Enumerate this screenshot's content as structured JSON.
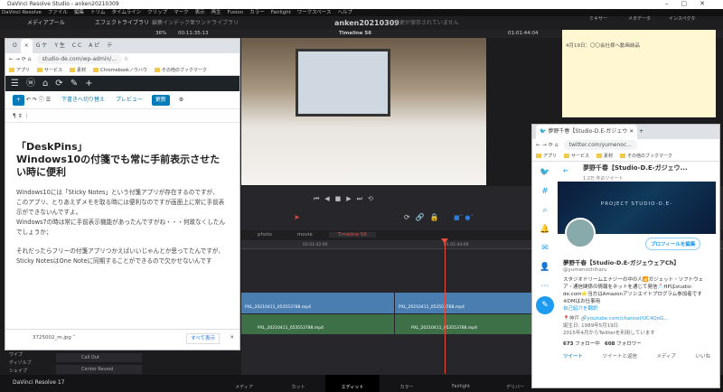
{
  "app": {
    "title": "DaVinci Resolve Studio - anken20210309",
    "menu": [
      "DaVinci Resolve",
      "ファイル",
      "編集",
      "トリム",
      "タイムライン",
      "クリップ",
      "マーク",
      "表示",
      "再生",
      "Fusion",
      "カラー",
      "Fairlight",
      "ワークスペース",
      "ヘルプ"
    ],
    "toolbar": {
      "media_pool": "メディアプール",
      "effects": "エフェクトライブラリ",
      "edit_index": "編集インデックス",
      "sound_library": "サウンドライブラリ",
      "project": "anken20210309",
      "unsaved": "変更が保存されていません",
      "mixer": "ミキサー",
      "metadata": "メタデータ",
      "inspector": "インスペクタ"
    },
    "viewer": {
      "zoom": "36%",
      "timecode": "00:11:35:13",
      "timeline_name": "Timeline 56",
      "current_tc": "01:01:44:04"
    },
    "timeline": {
      "tabs": [
        "photo",
        "movie",
        "Timeline 56"
      ],
      "ruler": [
        "01:01:42:00",
        "01:01:44:00"
      ],
      "clips": [
        "PXL_20210411_053553788.mp4",
        "PXL_20210411_053553788.mp4"
      ]
    },
    "effects_list": [
      "Call Out",
      "Center Reveal"
    ],
    "side_items": [
      "ワイプ",
      "ディゾルブ",
      "シェイプ"
    ],
    "pages": [
      "メディア",
      "カット",
      "エディット",
      "カラー",
      "Fairlight",
      "デリバー"
    ],
    "active_page": "エディット",
    "brand": "DaVinci Resolve 17",
    "accent": "#e64b3c"
  },
  "wp_browser": {
    "tabs": [
      "O",
      "×",
      "G ケ",
      "Y 生",
      "C C",
      "A ピ",
      "テ"
    ],
    "url": "studio-de.com/wp-admin/...",
    "bookmarks": [
      "アプリ",
      "サービス",
      "素材",
      "Chromebookノウハウ",
      "その他のブックマーク"
    ],
    "editor": {
      "draft": "下書きへ切り替え",
      "preview": "プレビュー",
      "update": "更新"
    },
    "title": "「DeskPins」\nWindows10の付箋でも常に手前表示させたい時に便利",
    "paragraphs": [
      "Windows10には「Sticky Notes」という付箋アプリが存在するのですが、",
      "このアプリ、とりあえずメモを取る時には便利なのですが画面上に常に手前表示ができないんですよ。",
      "Windows7の時は常に手前表示機能があったんですがね・・・何故なくしたんでしょうか；",
      "それだったらフリーの付箋アプリつかえばいいじゃんとか思ってたんですが、",
      "Sticky NotesはOne Noteに同期することができるので欠かせないんです"
    ],
    "download": {
      "file": "3725002_m.jpg",
      "show_all": "すべて表示"
    }
  },
  "sticky_note": {
    "text": "4月19日：〇〇会社様へ動画納品"
  },
  "twitter_browser": {
    "tab": "夢野千春【Studio-D.E-ガジェウ",
    "url": "twitter.com/yumenoc...",
    "bookmarks": [
      "アプリ",
      "サービス",
      "素材",
      "その他のブックマーク"
    ],
    "profile": {
      "header_name": "夢野千春【Studio-D.E-ガジェウ...",
      "tweet_count": "1.2万 件のツイート",
      "banner": "PROJECT STUDIO-D.E-",
      "edit_profile": "プロフィールを編集",
      "name": "夢野千春【Studio-D.E-ガジェウェアCh】",
      "handle": "@yumenochiharu",
      "bio": "スタジオドリームエナジーの中の人📶ガジェット・ソフトウェア・通信関係の情報をネットを通じて発信📩HPはstudio-de.com⭐当方はAmazonアソシエイトプログラム参加者です※DMはお仕事用",
      "translate": "自己紹介を翻訳",
      "location": "神戸",
      "link": "youtube.com/channel/UC4QoG...",
      "birthday": "誕生日: 1989年5月19日",
      "joined": "2015年4月からTwitterを利用しています",
      "following": "673",
      "following_label": "フォロー中",
      "followers": "608",
      "followers_label": "フォロワー",
      "tabs": [
        "ツイート",
        "ツイートと返信",
        "メディア",
        "いいね"
      ]
    }
  }
}
